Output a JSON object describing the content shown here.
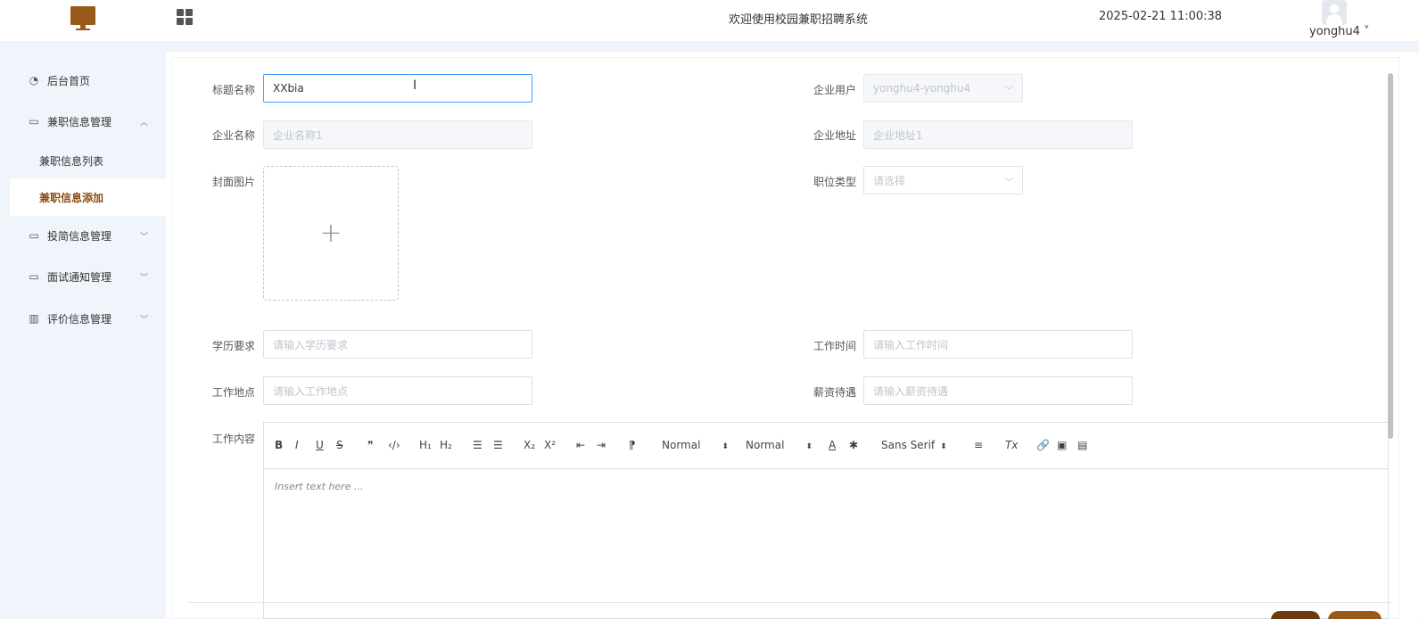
{
  "header": {
    "site_title": "欢迎使用校园兼职招聘系统",
    "datetime": "2025-02-21 11:00:38",
    "username": "yonghu4",
    "username_chevron": "˅"
  },
  "sidebar": {
    "items": [
      {
        "label": "后台首页",
        "icon": "clock-icon"
      },
      {
        "label": "兼职信息管理",
        "icon": "card-icon",
        "expanded": true
      },
      {
        "label": "兼职信息列表"
      },
      {
        "label": "兼职信息添加",
        "active": true
      },
      {
        "label": "投简信息管理",
        "icon": "card-icon"
      },
      {
        "label": "面试通知管理",
        "icon": "card-icon"
      },
      {
        "label": "评价信息管理",
        "icon": "chart-icon"
      }
    ]
  },
  "form": {
    "title_label": "标题名称",
    "title_value": "XXbia",
    "company_user_label": "企业用户",
    "company_user_value": "yonghu4-yonghu4",
    "company_name_label": "企业名称",
    "company_name_value": "企业名称1",
    "company_address_label": "企业地址",
    "company_address_value": "企业地址1",
    "cover_label": "封面图片",
    "job_type_label": "职位类型",
    "job_type_placeholder": "请选择",
    "education_label": "学历要求",
    "education_placeholder": "请输入学历要求",
    "work_time_label": "工作时间",
    "work_time_placeholder": "请输入工作时间",
    "location_label": "工作地点",
    "location_placeholder": "请输入工作地点",
    "salary_label": "薪资待遇",
    "salary_placeholder": "请输入薪资待遇",
    "content_label": "工作内容"
  },
  "editor": {
    "toolbar": {
      "bold": "B",
      "italic": "I",
      "underline": "U",
      "strike": "S",
      "quote": "❞",
      "code": "‹/›",
      "h1": "H₁",
      "h2": "H₂",
      "ordered": "☰",
      "bullet": "☰",
      "sub": "X₂",
      "sup": "X²",
      "outdent": "⇤",
      "indent": "⇥",
      "direction": "⁋",
      "size_select": "Normal",
      "header_select": "Normal",
      "color": "A",
      "background": "✱",
      "font_select": "Sans Serif",
      "align": "≡",
      "clean": "Tx",
      "link": "🔗",
      "image": "▣",
      "video": "▤"
    },
    "placeholder": "Insert text here ..."
  },
  "colors": {
    "accent": "#8b4a12",
    "logo": "#9a5a1c",
    "page_bg": "#f0f5fb",
    "focus_border": "#409eff"
  }
}
